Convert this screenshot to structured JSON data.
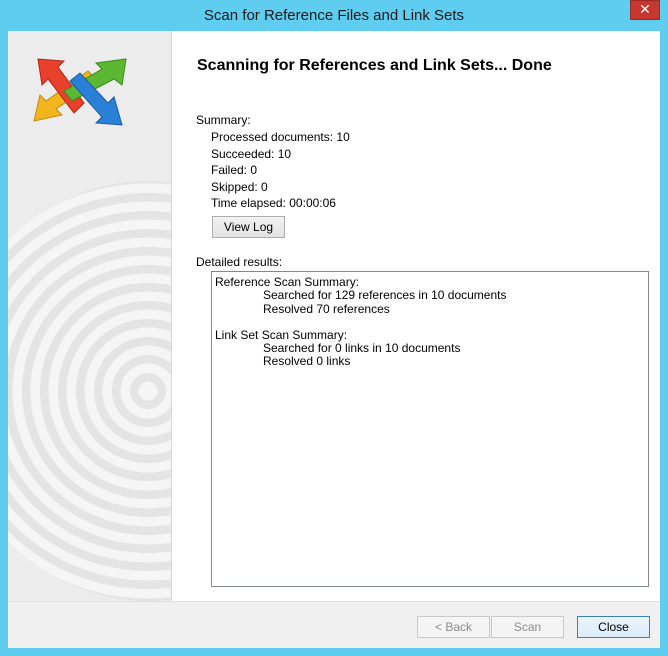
{
  "window": {
    "title": "Scan for Reference Files and Link Sets",
    "close_glyph": "✕"
  },
  "main": {
    "heading": "Scanning for References and Link Sets... Done",
    "summary_label": "Summary:",
    "summary": {
      "processed": "Processed documents: 10",
      "succeeded": "Succeeded: 10",
      "failed": "Failed: 0",
      "skipped": "Skipped: 0",
      "elapsed": "Time elapsed: 00:00:06"
    },
    "view_log_label": "View Log",
    "detailed_label": "Detailed results:",
    "details": {
      "reference_header": "Reference Scan Summary:",
      "reference_searched": "Searched for 129 references in 10 documents",
      "reference_resolved": "Resolved 70 references",
      "linkset_header": "Link Set Scan Summary:",
      "linkset_searched": "Searched for 0 links in 10 documents",
      "linkset_resolved": "Resolved 0 links"
    }
  },
  "footer": {
    "back_label": "< Back",
    "scan_label": "Scan",
    "close_label": "Close"
  },
  "colors": {
    "titlebar": "#5fcdef",
    "close_button": "#c7372f",
    "logo_red": "#e8402a",
    "logo_green": "#5cb832",
    "logo_yellow": "#f2b51e",
    "logo_blue": "#2a7fd6"
  },
  "icons": {
    "logo": "crossed-arrows-logo-icon",
    "close": "close-icon"
  }
}
